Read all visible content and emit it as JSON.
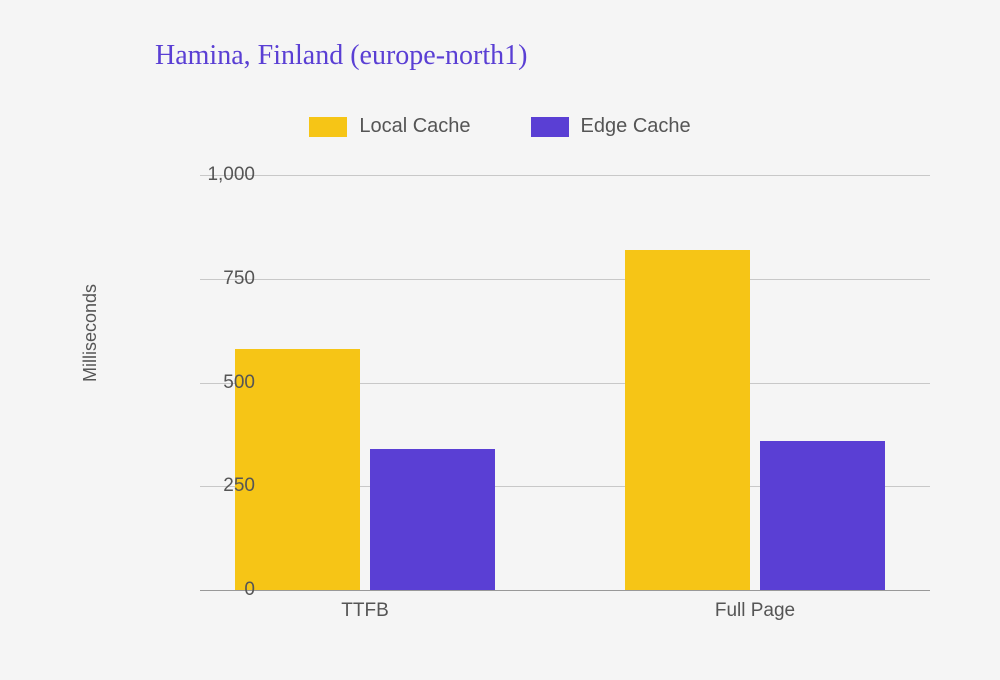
{
  "title": "Hamina, Finland (europe-north1)",
  "legend": {
    "local": "Local Cache",
    "edge": "Edge Cache"
  },
  "yaxis": {
    "title": "Milliseconds",
    "ticks": [
      "0",
      "250",
      "500",
      "750",
      "1,000"
    ]
  },
  "xaxis": {
    "ticks": [
      "TTFB",
      "Full Page"
    ]
  },
  "chart_data": {
    "type": "bar",
    "title": "Hamina, Finland (europe-north1)",
    "xlabel": "",
    "ylabel": "Milliseconds",
    "categories": [
      "TTFB",
      "Full Page"
    ],
    "series": [
      {
        "name": "Local Cache",
        "color": "#f6c516",
        "values": [
          580,
          820
        ]
      },
      {
        "name": "Edge Cache",
        "color": "#5a3fd4",
        "values": [
          340,
          360
        ]
      }
    ],
    "ylim": [
      0,
      1000
    ],
    "yticks": [
      0,
      250,
      500,
      750,
      1000
    ],
    "grid": true,
    "legend_position": "top"
  }
}
